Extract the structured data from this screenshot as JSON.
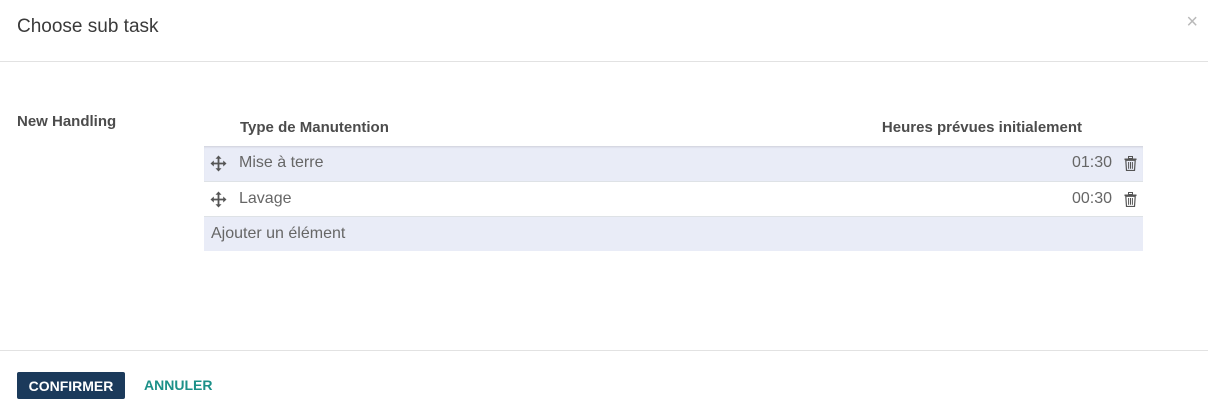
{
  "dialog": {
    "title": "Choose sub task",
    "close_symbol": "×"
  },
  "field": {
    "label": "New Handling"
  },
  "table": {
    "columns": [
      "Type de Manutention",
      "Heures prévues initialement"
    ],
    "rows": [
      {
        "type": "Mise à terre",
        "hours": "01:30"
      },
      {
        "type": "Lavage",
        "hours": "00:30"
      }
    ],
    "add_label": "Ajouter un élément"
  },
  "footer": {
    "confirm_label": "CONFIRMER",
    "cancel_label": "ANNULER"
  },
  "icons": {
    "drag_handle": "move-arrows-icon",
    "delete": "trash-icon",
    "close": "close-icon"
  },
  "colors": {
    "primary_button": "#1b3a5b",
    "secondary_link": "#1b9088",
    "row_highlight": "#e9ecf7"
  }
}
